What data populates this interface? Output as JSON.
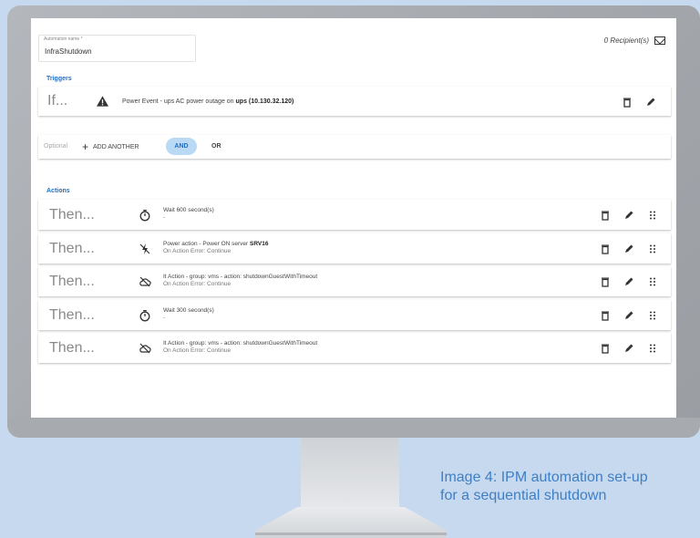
{
  "app": {
    "automation_name_label": "Automation name *",
    "automation_name_value": "InfraShutdown",
    "recipients": "0 Recipient(s)"
  },
  "triggers": {
    "title": "Triggers",
    "if_label": "If...",
    "text_prefix": "Power Event - ups AC power outage on ",
    "text_bold": "ups (10.130.32.120)"
  },
  "optional": {
    "label": "Optional",
    "add_another": "ADD ANOTHER",
    "and": "AND",
    "or": "OR"
  },
  "actions": {
    "title": "Actions",
    "then_label": "Then...",
    "items": [
      {
        "icon": "timer-icon",
        "line1_prefix": "Wait 600 second(s)",
        "line1_bold": "",
        "line2": "-"
      },
      {
        "icon": "power-off-icon",
        "line1_prefix": "Power action - Power ON server ",
        "line1_bold": "SRV16",
        "line2": "On Action Error: Continue"
      },
      {
        "icon": "cloud-off-icon",
        "line1_prefix": "It Action - group: vms - action: shutdownGuestWithTimeout",
        "line1_bold": "",
        "line2": "On Action Error: Continue"
      },
      {
        "icon": "timer-icon",
        "line1_prefix": "Wait 300 second(s)",
        "line1_bold": "",
        "line2": "-"
      },
      {
        "icon": "cloud-off-icon",
        "line1_prefix": "It Action - group: vms - action: shutdownGuestWithTimeout",
        "line1_bold": "",
        "line2": "On Action Error: Continue"
      }
    ]
  },
  "caption": {
    "line1": "Image 4: IPM automation set-up",
    "line2": "for a sequential shutdown"
  },
  "colors": {
    "background": "#c7d9ee",
    "accent_blue": "#1f6fc5",
    "and_pill": "#b9d9f5",
    "caption": "#3f7fc4"
  }
}
